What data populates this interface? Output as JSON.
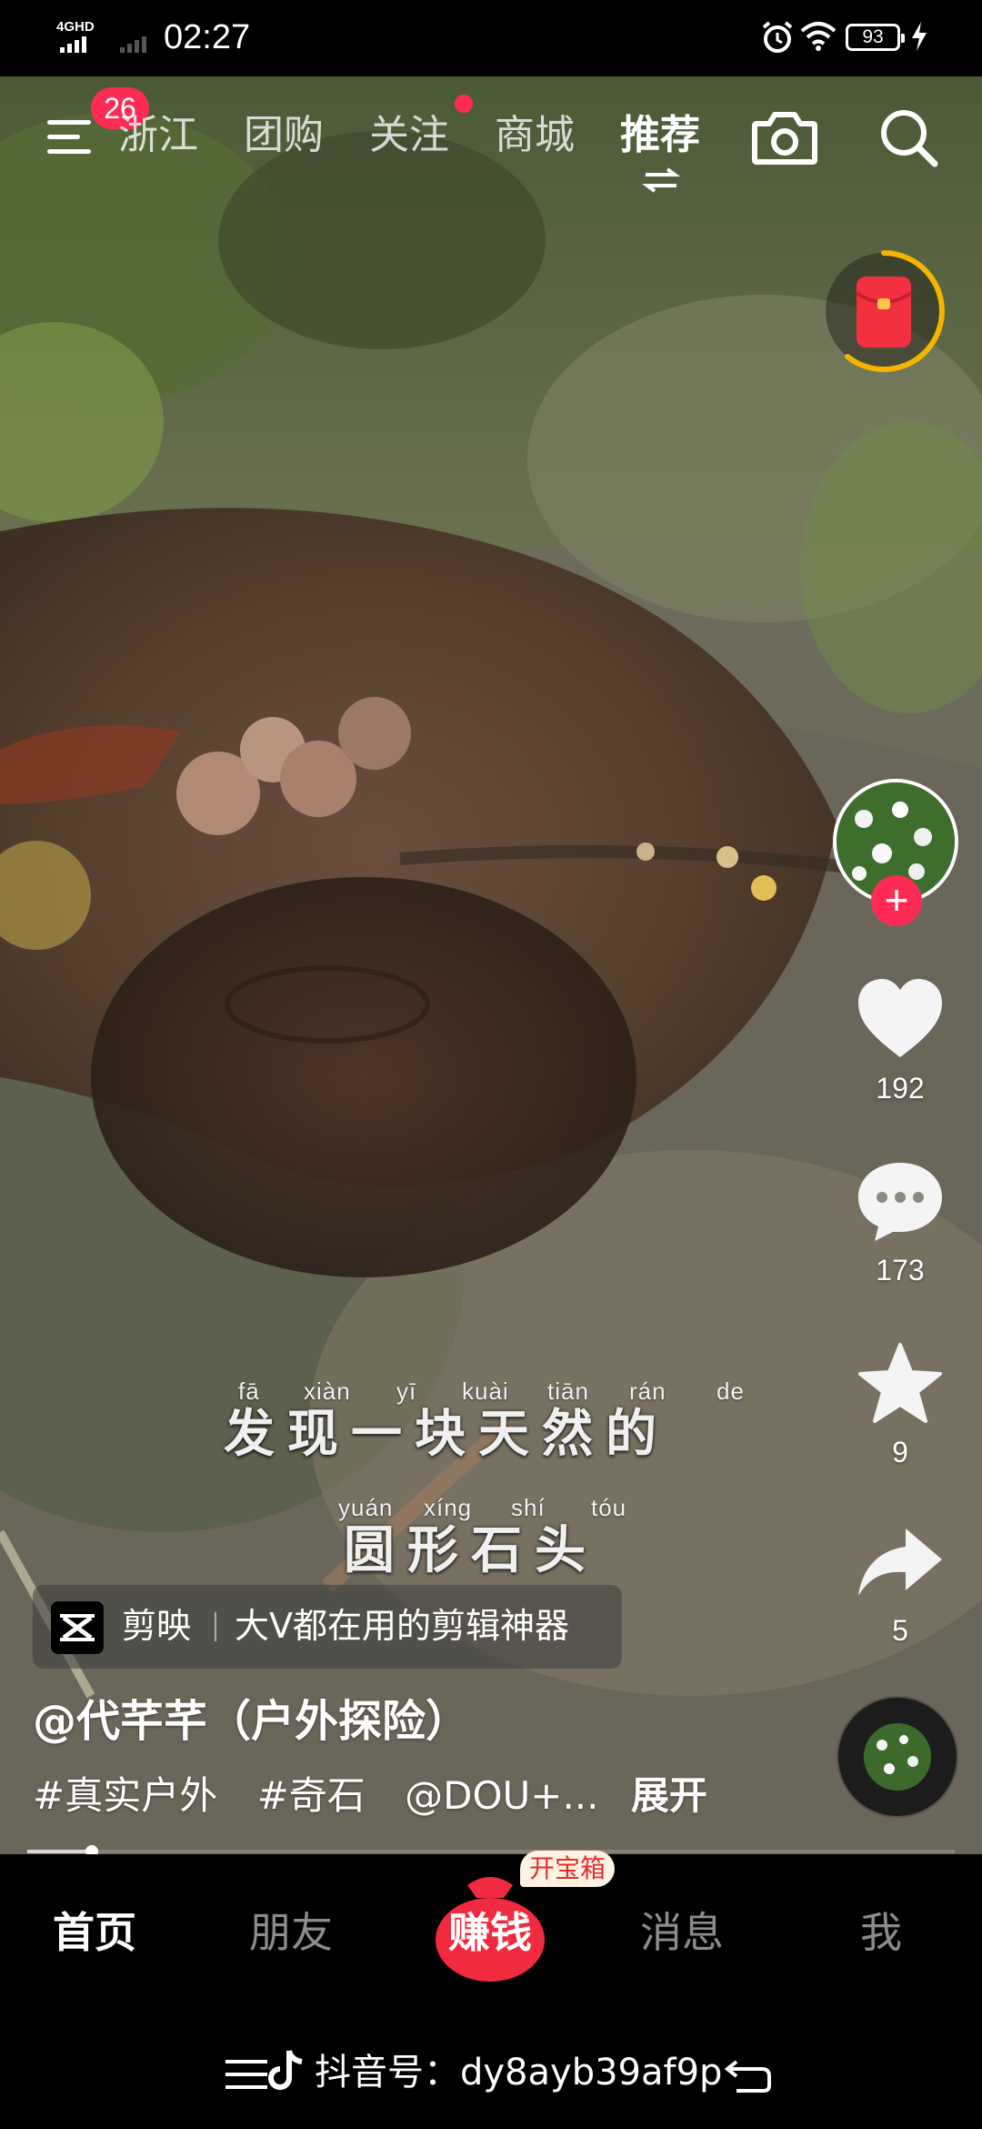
{
  "status_bar": {
    "network": "4GHD",
    "time": "02:27",
    "battery": "93"
  },
  "top_nav": {
    "menu_badge": "26",
    "tabs": [
      {
        "label": "浙江"
      },
      {
        "label": "团购"
      },
      {
        "label": "关注"
      },
      {
        "label": "商城"
      },
      {
        "label": "推荐"
      }
    ],
    "active_tab": "推荐"
  },
  "video": {
    "subtitle_line1": {
      "pinyin": [
        "fā",
        "xiàn",
        "yī",
        "kuài",
        "tiān",
        "rán",
        "de"
      ],
      "text": "发现一块天然的"
    },
    "subtitle_line2": {
      "pinyin": [
        "yuán",
        "xíng",
        "shí",
        "tóu"
      ],
      "text": "圆形石头"
    }
  },
  "side_rail": {
    "likes": "192",
    "comments": "173",
    "favorites": "9",
    "shares": "5"
  },
  "ad": {
    "brand": "剪映",
    "text": "大V都在用的剪辑神器"
  },
  "post": {
    "author": "@代芊芊（户外探险）",
    "tags": [
      "#真实户外",
      "#奇石",
      "@DOU+..."
    ],
    "expand": "展开"
  },
  "playback": {
    "progress": 0.07
  },
  "bottom_nav": {
    "home": "首页",
    "friends": "朋友",
    "earn": "赚钱",
    "treasure_badge": "开宝箱",
    "messages": "消息",
    "me": "我"
  },
  "system_bar": {
    "douyin_id": "抖音号：dy8ayb39af9p"
  },
  "colors": {
    "accent": "#fe2c55",
    "earn_red": "#f22a3f",
    "background": "#000000"
  }
}
